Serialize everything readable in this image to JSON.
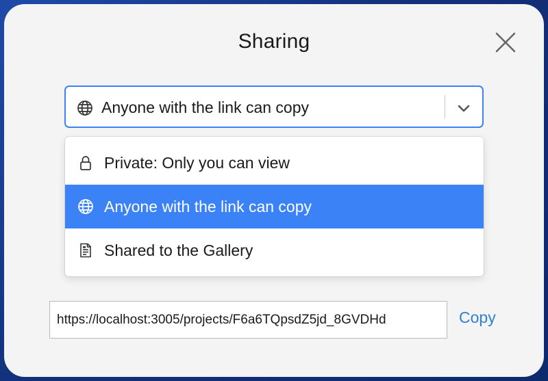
{
  "dialog": {
    "title": "Sharing",
    "close_icon": "close-icon"
  },
  "select": {
    "icon": "globe-icon",
    "value": "Anyone with the link can copy",
    "chevron_icon": "chevron-down-icon"
  },
  "menu": {
    "items": [
      {
        "icon": "lock-icon",
        "label": "Private: Only you can view",
        "selected": false
      },
      {
        "icon": "globe-icon",
        "label": "Anyone with the link can copy",
        "selected": true
      },
      {
        "icon": "gallery-document-icon",
        "label": "Shared to the Gallery",
        "selected": false
      }
    ]
  },
  "share": {
    "url": "https://localhost:3005/projects/F6a6TQpsdZ5jd_8GVDHd",
    "copy_label": "Copy"
  },
  "colors": {
    "accent": "#3b82f6",
    "link": "#2f7fd6",
    "dialog_bg": "#f4f4f4",
    "frame": "#12307a"
  }
}
